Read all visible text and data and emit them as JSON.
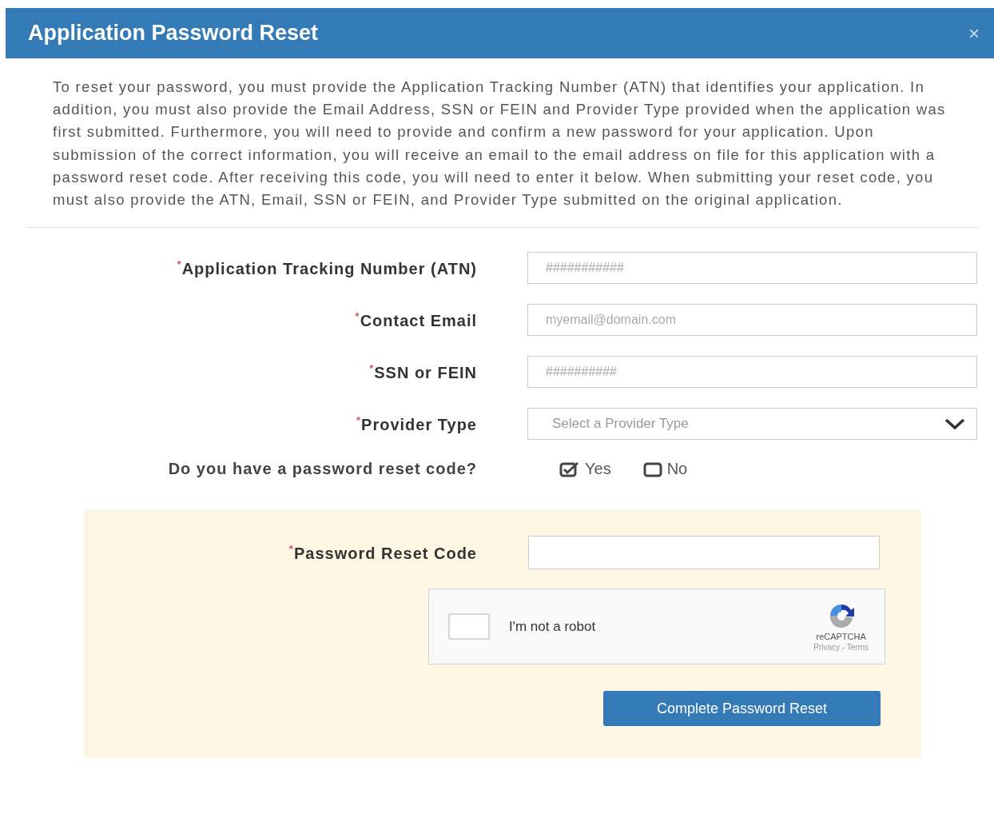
{
  "dialog": {
    "title": "Application Password Reset",
    "close": "×"
  },
  "intro": "To reset your password, you must provide the Application Tracking Number (ATN) that identifies your application. In addition, you must also provide the Email Address, SSN or FEIN and Provider Type provided when the application was first submitted. Furthermore, you will need to provide and confirm a new password for your application. Upon submission of the correct information, you will receive an email to the email address on file for this application with a password reset code. After receiving this code, you will need to enter it below. When submitting your reset code, you must also provide the ATN, Email, SSN or FEIN, and Provider Type submitted on the original application.",
  "fields": [
    {
      "kind": "input",
      "label": "$^{*}$Application Tracking Number (ATN)",
      "placeholder": "###########"
    },
    {
      "kind": "input",
      "label": "$^{*}$Contact Email",
      "placeholder": "myemail@domain.com"
    },
    {
      "kind": "input",
      "label": "$^{*}$SSN or FEIN",
      "placeholder": "##########"
    },
    {
      "kind": "select",
      "label": "$^{*}$Provider Type",
      "placeholder": "Select a Provider Type"
    }
  ],
  "reset_question": {
    "label": "Do you have a password reset code?",
    "options": [
      {
        "label": "Yes",
        "checked": true
      },
      {
        "label": "No",
        "checked": false
      }
    ]
  },
  "reset_panel": {
    "label": "$^{*}$Password Reset Code",
    "captcha": {
      "label": "I'm not a robot",
      "checked": false,
      "brand": "reCAPTCHA",
      "links": "Privacy - Terms"
    },
    "submit": "Complete Password Reset"
  }
}
